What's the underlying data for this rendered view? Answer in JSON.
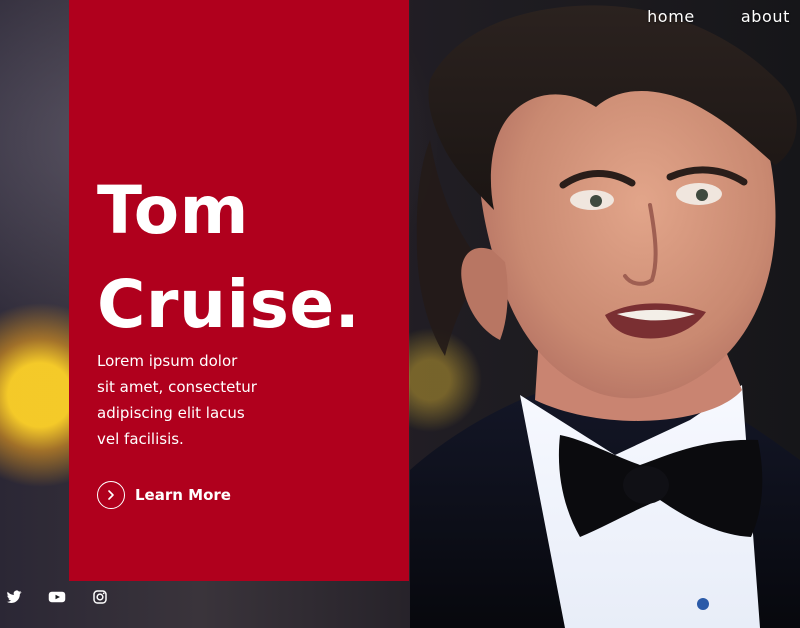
{
  "nav": {
    "items": [
      {
        "label": "home"
      },
      {
        "label": "about"
      }
    ]
  },
  "hero": {
    "title_lines": [
      "Tom",
      "Cruise."
    ],
    "description_lines": [
      "Lorem ipsum dolor",
      "sit amet, consectetur",
      "adipiscing elit lacus",
      "vel facilisis."
    ],
    "cta": {
      "label": "Learn More",
      "icon": "chevron-right-icon"
    }
  },
  "social": [
    {
      "icon": "twitter-icon"
    },
    {
      "icon": "youtube-icon"
    },
    {
      "icon": "instagram-icon"
    }
  ],
  "colors": {
    "accent_red": "#b0001d",
    "text": "#ffffff"
  }
}
